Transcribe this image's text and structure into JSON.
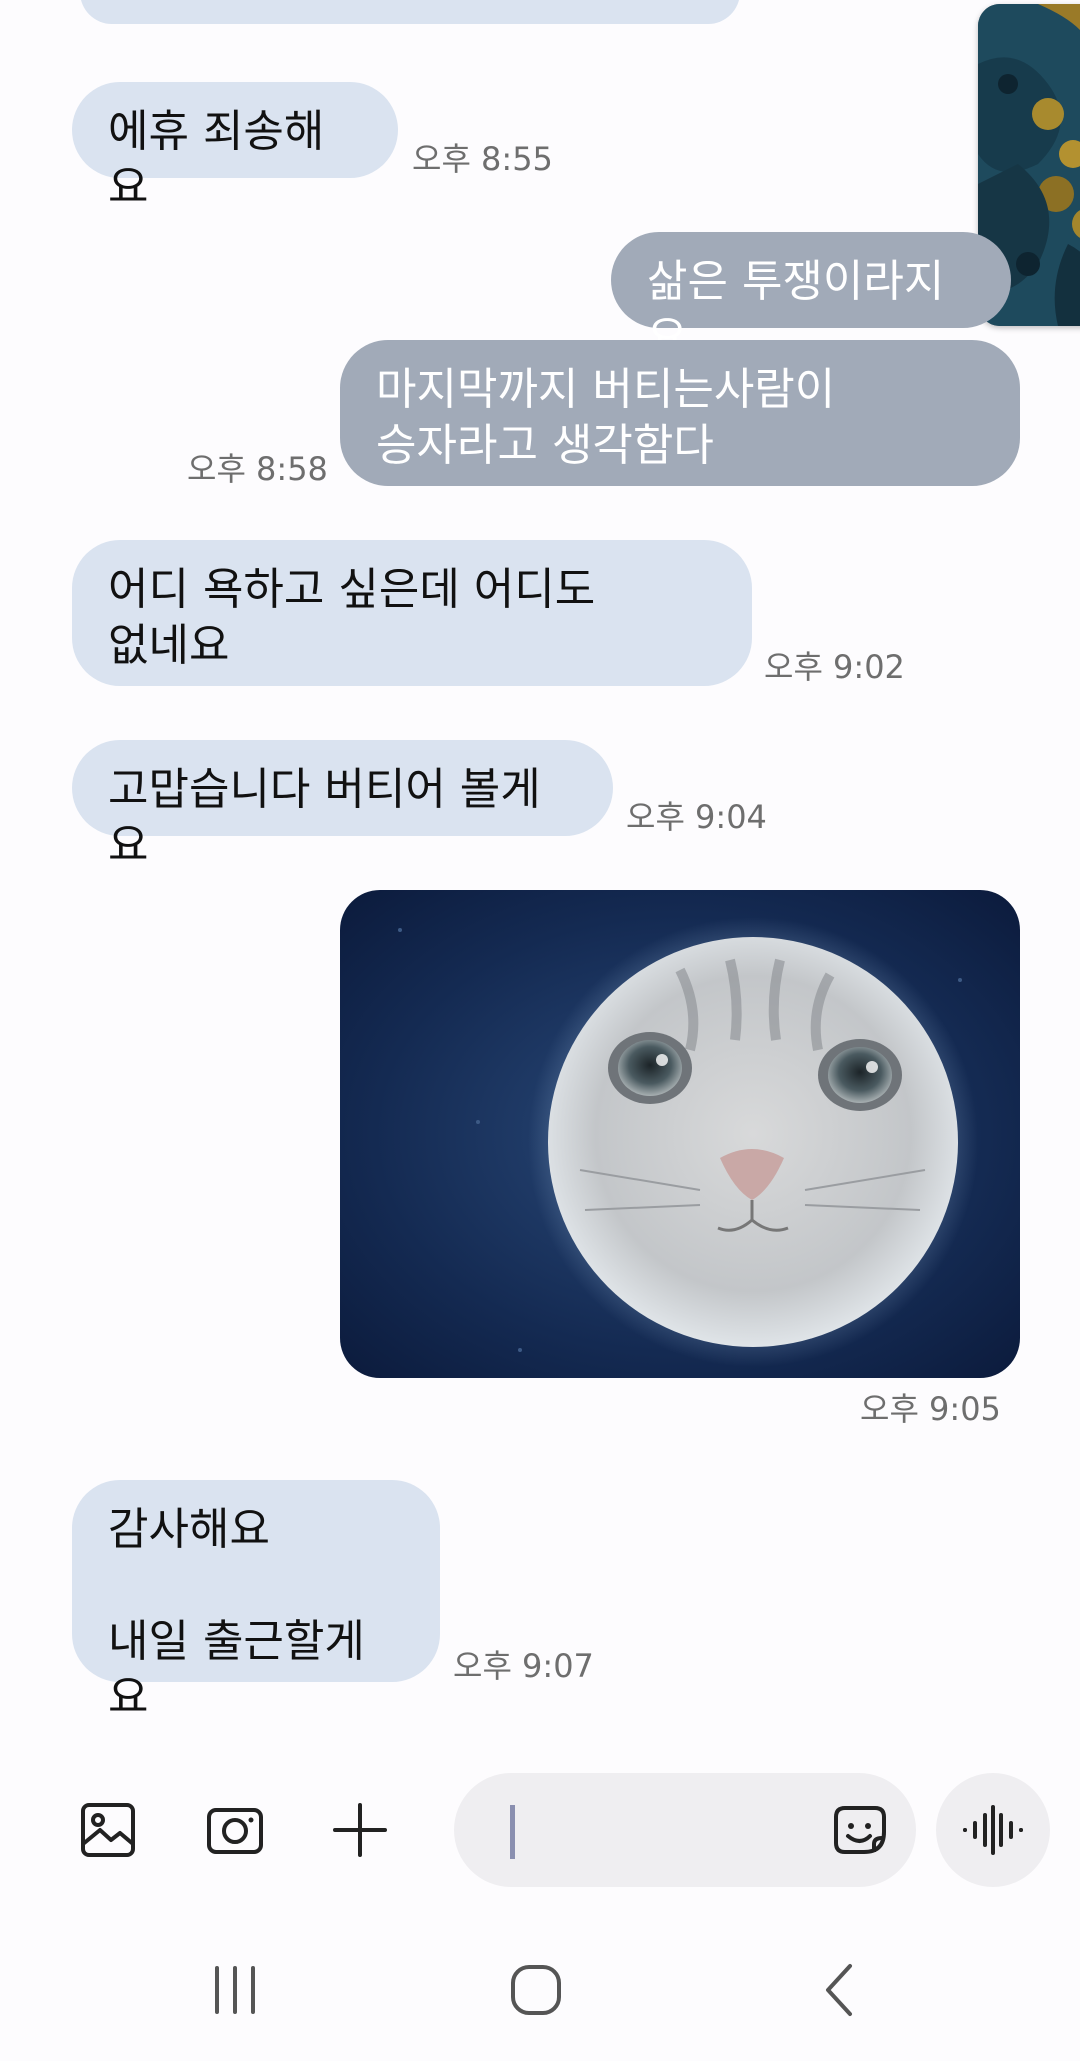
{
  "messages": [
    {
      "text": "에휴 죄송해요",
      "time": "오후 8:55",
      "direction": "incoming"
    },
    {
      "text": "삶은 투쟁이라지요",
      "direction": "outgoing"
    },
    {
      "text": "마지막까지 버티는사람이\n승자라고 생각함다",
      "time": "오후 8:58",
      "direction": "outgoing"
    },
    {
      "text": "어디 욕하고 싶은데 어디도\n없네요",
      "time": "오후 9:02",
      "direction": "incoming"
    },
    {
      "text": "고맙습니다 버티어 볼게요",
      "time": "오후 9:04",
      "direction": "incoming"
    },
    {
      "type": "image",
      "image_name": "cat-face-moon-image",
      "time": "오후 9:05",
      "direction": "outgoing"
    },
    {
      "text": "감사해요\n\n내일 출근할게요",
      "time": "오후 9:07",
      "direction": "incoming"
    }
  ],
  "composer": {
    "gallery_icon": "gallery-icon",
    "camera_icon": "camera-icon",
    "add_icon": "plus-icon",
    "emoji_icon": "sticker-emoji-icon",
    "voice_icon": "voice-waveform-icon",
    "text_value": ""
  },
  "navigation": {
    "recents_icon": "recent-apps-icon",
    "home_icon": "home-icon",
    "back_icon": "back-icon"
  },
  "colors": {
    "incoming_bubble": "#dae3f0",
    "outgoing_bubble": "#a1aab8",
    "background": "#fdfcfe",
    "timestamp": "#6e6e6e"
  }
}
